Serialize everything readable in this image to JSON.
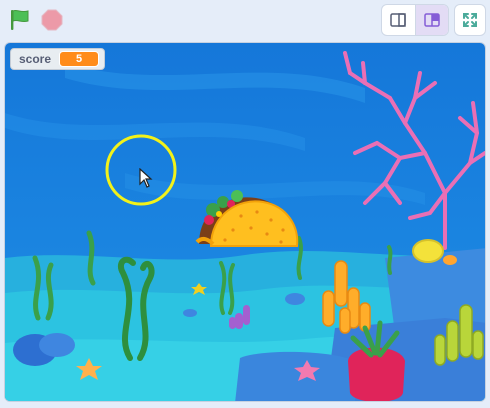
{
  "toolbar": {
    "green_flag_icon": "green-flag-icon",
    "stop_icon": "stop-sign-icon",
    "small_stage_icon": "small-stage-layout-icon",
    "normal_stage_icon": "normal-stage-layout-icon",
    "fullscreen_icon": "fullscreen-icon"
  },
  "stage": {
    "monitor": {
      "label": "score",
      "value": "5"
    },
    "sprites": [
      "taco",
      "ring-target",
      "mouse-cursor"
    ],
    "backdrop": "underwater-reef"
  },
  "colors": {
    "flag": "#4cbf56",
    "stop": "#ec9aa8",
    "monitor_value_bg": "#ff8c1a",
    "water": "#1b86e0",
    "ring": "#f2f21a"
  }
}
